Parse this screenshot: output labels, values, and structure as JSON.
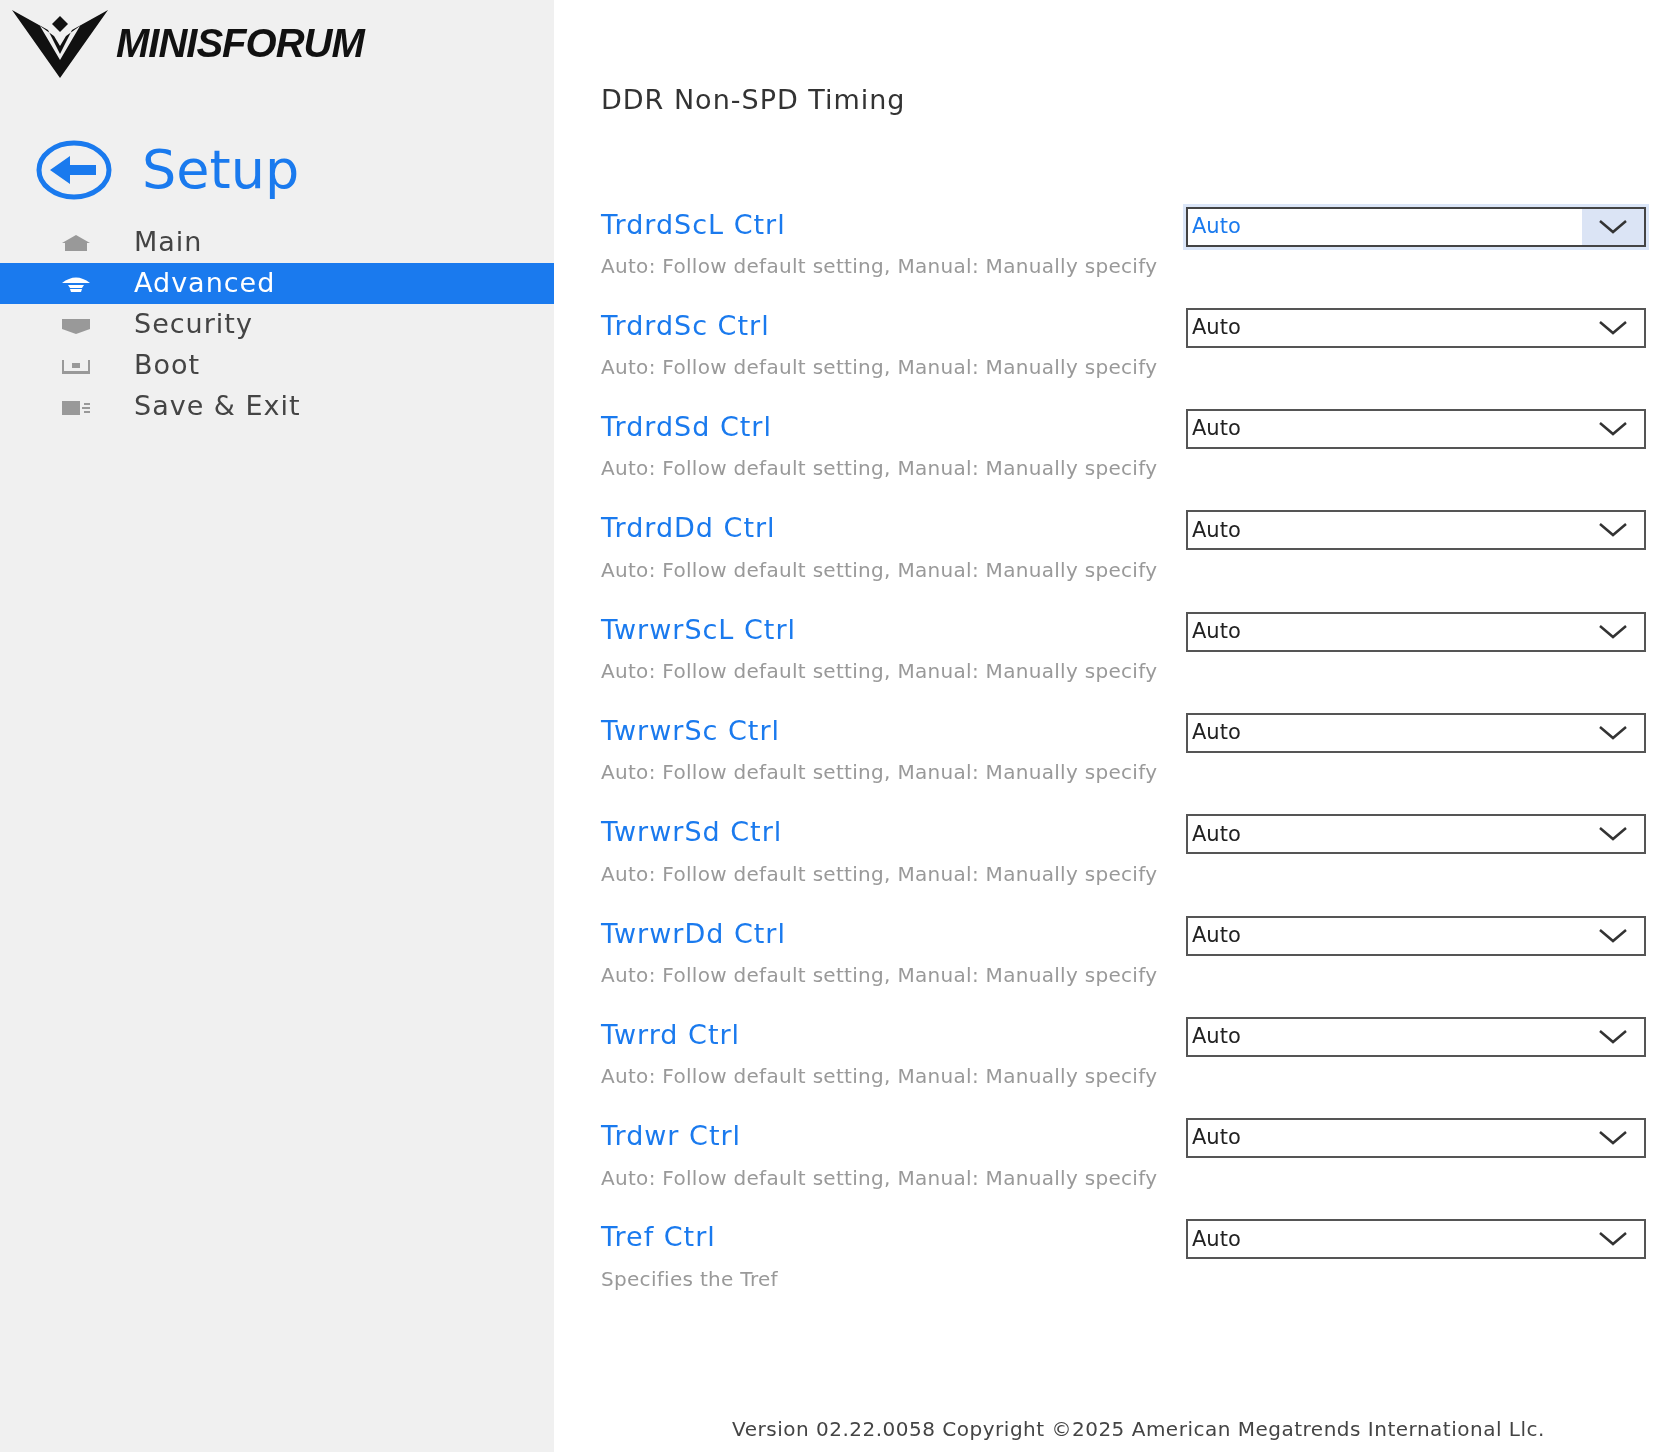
{
  "logo": {
    "text": "MINISFORUM"
  },
  "sidebar": {
    "title": "Setup",
    "items": [
      {
        "label": "Main",
        "selected": false
      },
      {
        "label": "Advanced",
        "selected": true
      },
      {
        "label": "Security",
        "selected": false
      },
      {
        "label": "Boot",
        "selected": false
      },
      {
        "label": "Save & Exit",
        "selected": false
      }
    ]
  },
  "page_title": "DDR Non-SPD Timing",
  "settings": [
    {
      "label": "TrdrdScL Ctrl",
      "description": "Auto: Follow default setting, Manual: Manually specify",
      "value": "Auto",
      "selected": true
    },
    {
      "label": "TrdrdSc Ctrl",
      "description": "Auto: Follow default setting, Manual: Manually specify",
      "value": "Auto",
      "selected": false
    },
    {
      "label": "TrdrdSd Ctrl",
      "description": "Auto: Follow default setting, Manual: Manually specify",
      "value": "Auto",
      "selected": false
    },
    {
      "label": "TrdrdDd Ctrl",
      "description": "Auto: Follow default setting, Manual: Manually specify",
      "value": "Auto",
      "selected": false
    },
    {
      "label": "TwrwrScL Ctrl",
      "description": "Auto: Follow default setting, Manual: Manually specify",
      "value": "Auto",
      "selected": false
    },
    {
      "label": "TwrwrSc Ctrl",
      "description": "Auto: Follow default setting, Manual: Manually specify",
      "value": "Auto",
      "selected": false
    },
    {
      "label": "TwrwrSd Ctrl",
      "description": "Auto: Follow default setting, Manual: Manually specify",
      "value": "Auto",
      "selected": false
    },
    {
      "label": "TwrwrDd Ctrl",
      "description": "Auto: Follow default setting, Manual: Manually specify",
      "value": "Auto",
      "selected": false
    },
    {
      "label": "Twrrd Ctrl",
      "description": "Auto: Follow default setting, Manual: Manually specify",
      "value": "Auto",
      "selected": false
    },
    {
      "label": "Trdwr Ctrl",
      "description": "Auto: Follow default setting, Manual: Manually specify",
      "value": "Auto",
      "selected": false
    },
    {
      "label": "Tref Ctrl",
      "description": "Specifies the Tref",
      "value": "Auto",
      "selected": false
    }
  ],
  "footer": "Version 02.22.0058 Copyright ©2025 American Megatrends International Llc."
}
